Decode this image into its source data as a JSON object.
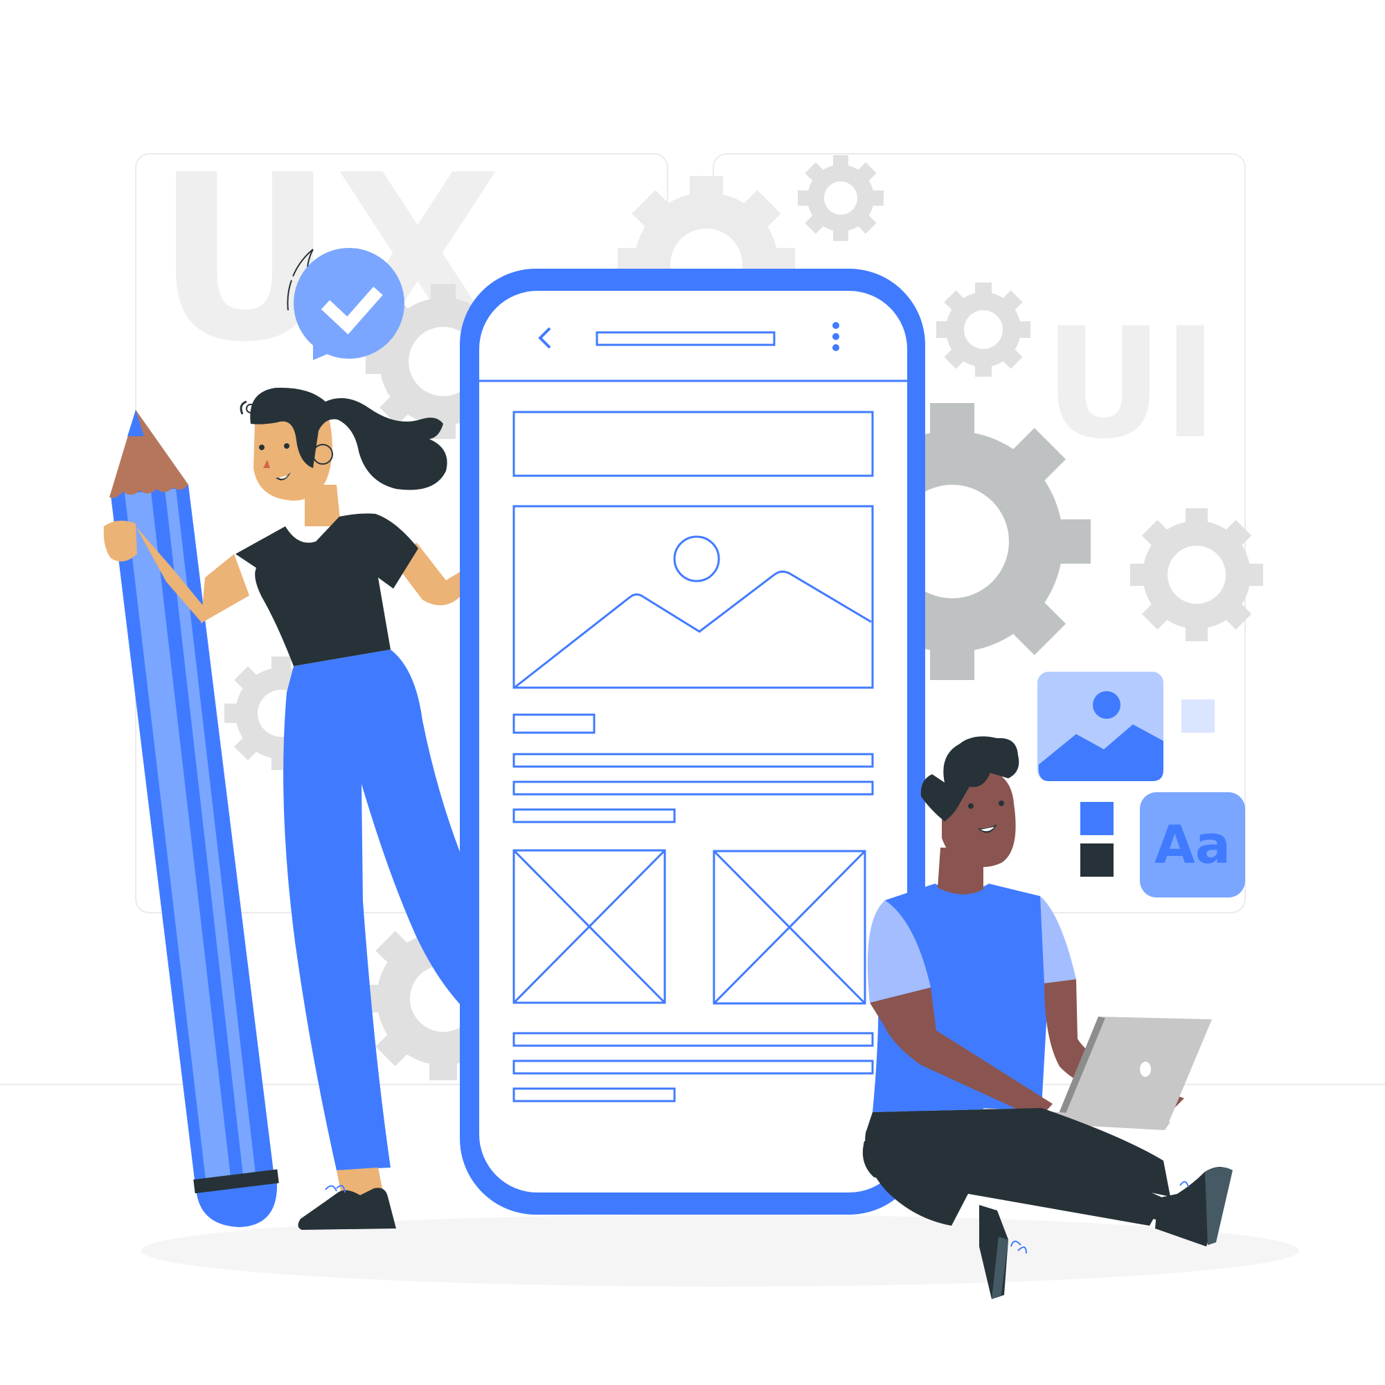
{
  "panels": {
    "left_letters": "UX",
    "right_letters": "UI"
  },
  "typography_card": {
    "label": "Aa"
  },
  "colors": {
    "accent": "#407bff",
    "accent_light": "#7aa6ff",
    "accent_pale": "#b3cbff",
    "dark": "#263238",
    "gear_grey": "#bfc2c3",
    "gear_light": "#e0e0e0",
    "skin_light": "#ebb376",
    "skin_dark": "#8a5550"
  },
  "icons": {
    "check_bubble": "check-bubble-icon",
    "back": "chevron-left-icon",
    "more": "kebab-menu-icon",
    "image": "image-placeholder-icon",
    "laptop_logo": "laptop-logo-icon"
  }
}
